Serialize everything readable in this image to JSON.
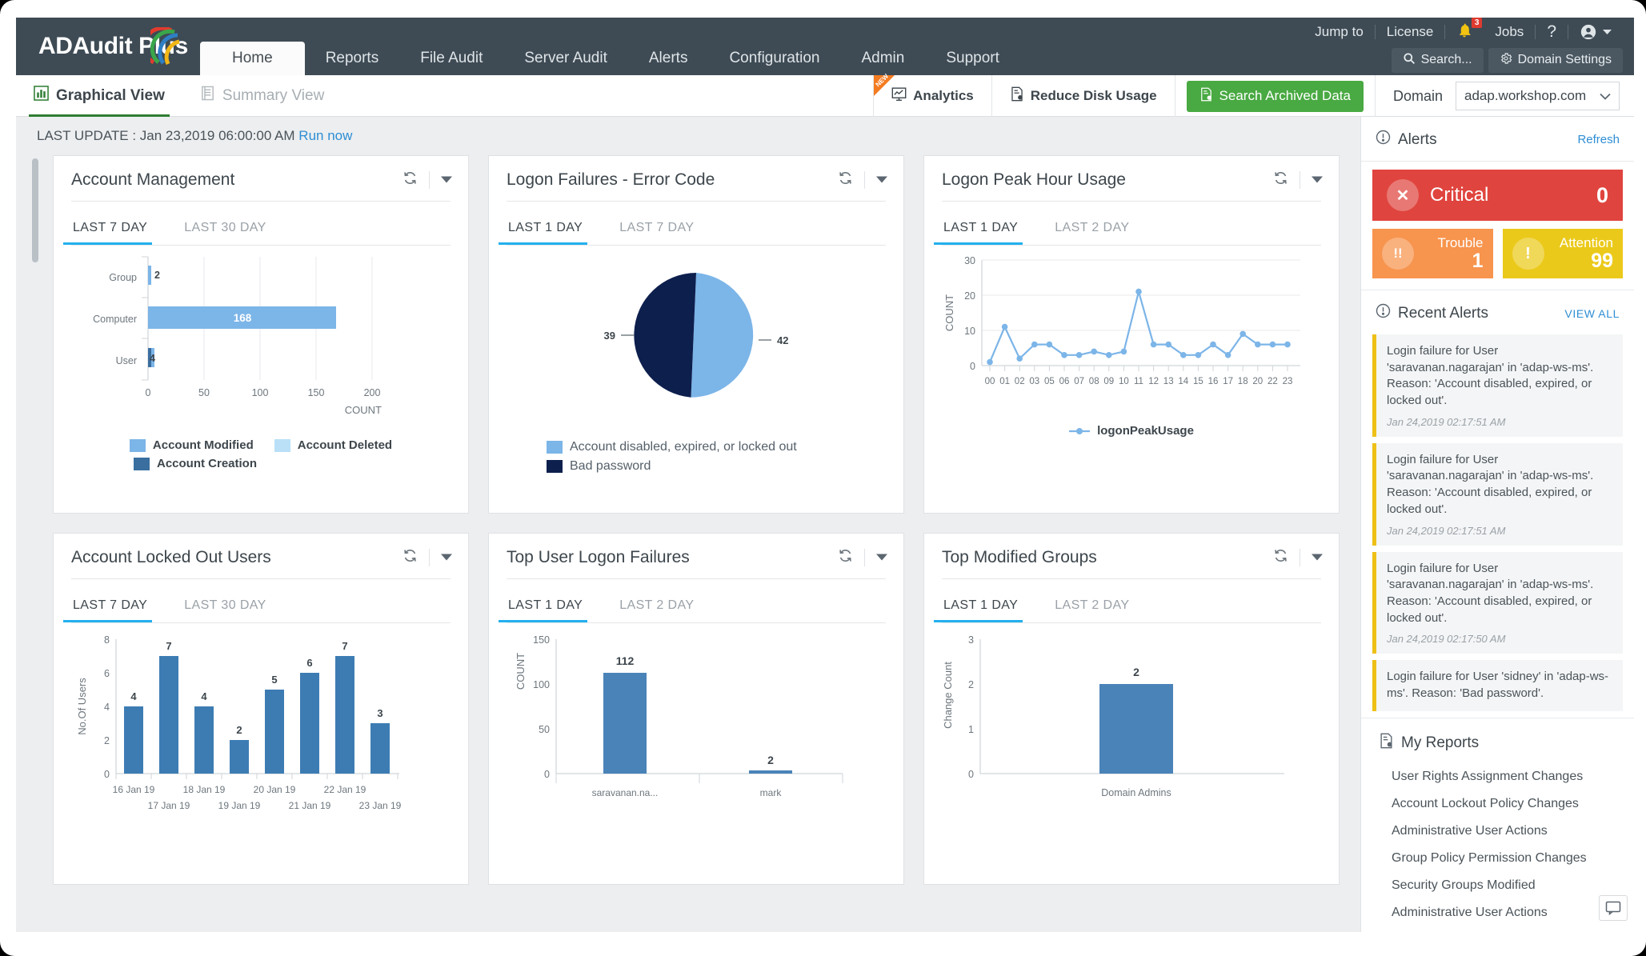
{
  "app": {
    "name": "ADAudit Plus"
  },
  "topnav": {
    "items": [
      {
        "label": "Home",
        "active": true
      },
      {
        "label": "Reports",
        "active": false
      },
      {
        "label": "File Audit",
        "active": false
      },
      {
        "label": "Server Audit",
        "active": false
      },
      {
        "label": "Alerts",
        "active": false
      },
      {
        "label": "Configuration",
        "active": false
      },
      {
        "label": "Admin",
        "active": false
      },
      {
        "label": "Support",
        "active": false
      }
    ],
    "jump_to": "Jump to",
    "license": "License",
    "notification_count": "3",
    "jobs": "Jobs",
    "help": "?",
    "search_button": "Search...",
    "domain_settings_button": "Domain Settings"
  },
  "subbar": {
    "graphical_view": "Graphical View",
    "summary_view": "Summary View",
    "analytics": "Analytics",
    "analytics_flag": "NEW",
    "reduce_disk_usage": "Reduce Disk Usage",
    "search_archived_data": "Search Archived Data",
    "domain_label": "Domain",
    "domain_value": "adap.workshop.com"
  },
  "last_update": {
    "prefix": "LAST UPDATE : Jan 23,2019 06:00:00 AM",
    "run_now": "Run now"
  },
  "cards": [
    {
      "title": "Account Management",
      "tabs": [
        {
          "label": "LAST 7 DAY",
          "active": true
        },
        {
          "label": "LAST 30 DAY",
          "active": false
        }
      ]
    },
    {
      "title": "Logon Failures - Error Code",
      "tabs": [
        {
          "label": "LAST 1 DAY",
          "active": true
        },
        {
          "label": "LAST 7 DAY",
          "active": false
        }
      ]
    },
    {
      "title": "Logon Peak Hour Usage",
      "tabs": [
        {
          "label": "LAST 1 DAY",
          "active": true
        },
        {
          "label": "LAST 2 DAY",
          "active": false
        }
      ]
    },
    {
      "title": "Account Locked Out Users",
      "tabs": [
        {
          "label": "LAST 7 DAY",
          "active": true
        },
        {
          "label": "LAST 30 DAY",
          "active": false
        }
      ]
    },
    {
      "title": "Top User Logon Failures",
      "tabs": [
        {
          "label": "LAST 1 DAY",
          "active": true
        },
        {
          "label": "LAST 2 DAY",
          "active": false
        }
      ]
    },
    {
      "title": "Top Modified Groups",
      "tabs": [
        {
          "label": "LAST 1 DAY",
          "active": true
        },
        {
          "label": "LAST 2 DAY",
          "active": false
        }
      ]
    }
  ],
  "chart_data": [
    {
      "type": "bar",
      "orientation": "horizontal",
      "title": "Account Management",
      "categories": [
        "Group",
        "Computer",
        "User"
      ],
      "series": [
        {
          "name": "Account Modified",
          "color": "#7cb5e8",
          "values": [
            2,
            168,
            4
          ]
        },
        {
          "name": "Account Deleted",
          "color": "#b9e0f7",
          "values": [
            0,
            0,
            0
          ]
        },
        {
          "name": "Account Creation",
          "color": "#3a6e9f",
          "values": [
            0,
            0,
            1
          ]
        }
      ],
      "xlabel": "COUNT",
      "ylabel": "",
      "xlim": [
        0,
        200
      ],
      "xticks": [
        0,
        50,
        100,
        150,
        200
      ],
      "grid": true,
      "legend_position": "bottom",
      "bar_labels": [
        "2",
        "168",
        "4"
      ]
    },
    {
      "type": "pie",
      "title": "Logon Failures - Error Code",
      "labels": [
        "Account disabled, expired, or locked out",
        "Bad password"
      ],
      "values": [
        42,
        39
      ],
      "colors": [
        "#7cb5e8",
        "#0d1f4d"
      ],
      "data_labels": [
        "42",
        "39"
      ],
      "legend_position": "bottom"
    },
    {
      "type": "line",
      "title": "Logon Peak Hour Usage",
      "x": [
        "00",
        "01",
        "02",
        "03",
        "05",
        "06",
        "07",
        "08",
        "09",
        "10",
        "11",
        "12",
        "13",
        "14",
        "15",
        "16",
        "17",
        "18",
        "20",
        "22",
        "23"
      ],
      "series": [
        {
          "name": "logonPeakUsage",
          "color": "#7cb5e8",
          "values": [
            1,
            11,
            2,
            6,
            6,
            3,
            3,
            4,
            3,
            4,
            21,
            6,
            6,
            3,
            3,
            6,
            3,
            9,
            6,
            6,
            6
          ]
        }
      ],
      "ylabel": "COUNT",
      "xlabel": "",
      "ylim": [
        0,
        30
      ],
      "yticks": [
        0,
        10,
        20,
        30
      ],
      "grid": true,
      "legend_position": "bottom"
    },
    {
      "type": "bar",
      "orientation": "vertical",
      "title": "Account Locked Out Users",
      "categories": [
        "16 Jan 19",
        "17 Jan 19",
        "18 Jan 19",
        "19 Jan 19",
        "20 Jan 19",
        "21 Jan 19",
        "22 Jan 19",
        "23 Jan 19"
      ],
      "values": [
        4,
        7,
        4,
        2,
        5,
        6,
        7,
        3
      ],
      "color": "#3d7cb3",
      "ylabel": "No.Of Users",
      "xlabel": "",
      "ylim": [
        0,
        8
      ],
      "yticks": [
        0,
        2,
        4,
        6,
        8
      ],
      "data_labels": [
        "4",
        "7",
        "4",
        "2",
        "5",
        "6",
        "7",
        "3"
      ]
    },
    {
      "type": "bar",
      "orientation": "vertical",
      "title": "Top User Logon Failures",
      "categories": [
        "saravanan.na...",
        "mark"
      ],
      "values": [
        112,
        2
      ],
      "color": "#4a83b8",
      "ylabel": "COUNT",
      "xlabel": "",
      "ylim": [
        0,
        150
      ],
      "yticks": [
        0,
        50,
        100,
        150
      ],
      "data_labels": [
        "112",
        "2"
      ]
    },
    {
      "type": "bar",
      "orientation": "vertical",
      "title": "Top Modified Groups",
      "categories": [
        "Domain Admins"
      ],
      "values": [
        2
      ],
      "color": "#4a83b8",
      "ylabel": "Change Count",
      "xlabel": "",
      "ylim": [
        0,
        3
      ],
      "yticks": [
        0,
        1,
        2,
        3
      ],
      "data_labels": [
        "2"
      ]
    }
  ],
  "sidebar": {
    "alerts": {
      "title": "Alerts",
      "refresh": "Refresh",
      "critical_label": "Critical",
      "critical_count": "0",
      "trouble_label": "Trouble",
      "trouble_count": "1",
      "attention_label": "Attention",
      "attention_count": "99"
    },
    "recent_alerts": {
      "title": "Recent Alerts",
      "view_all": "VIEW ALL",
      "items": [
        {
          "text": "Login failure for User 'saravanan.nagarajan' in 'adap-ws-ms'. Reason: 'Account disabled, expired, or locked out'.",
          "time": "Jan 24,2019 02:17:51 AM"
        },
        {
          "text": "Login failure for User 'saravanan.nagarajan' in 'adap-ws-ms'. Reason: 'Account disabled, expired, or locked out'.",
          "time": "Jan 24,2019 02:17:51 AM"
        },
        {
          "text": "Login failure for User 'saravanan.nagarajan' in 'adap-ws-ms'. Reason: 'Account disabled, expired, or locked out'.",
          "time": "Jan 24,2019 02:17:50 AM"
        },
        {
          "text": "Login failure for User 'sidney' in 'adap-ws-ms'. Reason: 'Bad password'.",
          "time": ""
        }
      ]
    },
    "my_reports": {
      "title": "My Reports",
      "items": [
        "User Rights Assignment Changes",
        "Account Lockout Policy Changes",
        "Administrative User Actions",
        "Group Policy Permission Changes",
        "Security Groups Modified",
        "Administrative User Actions"
      ]
    }
  },
  "colors": {
    "topbar": "#3e4b55",
    "accent_green": "#49a942",
    "accent_blue": "#24b0ed",
    "critical": "#e0443e",
    "trouble": "#f7944d",
    "attention": "#ebc91a"
  }
}
